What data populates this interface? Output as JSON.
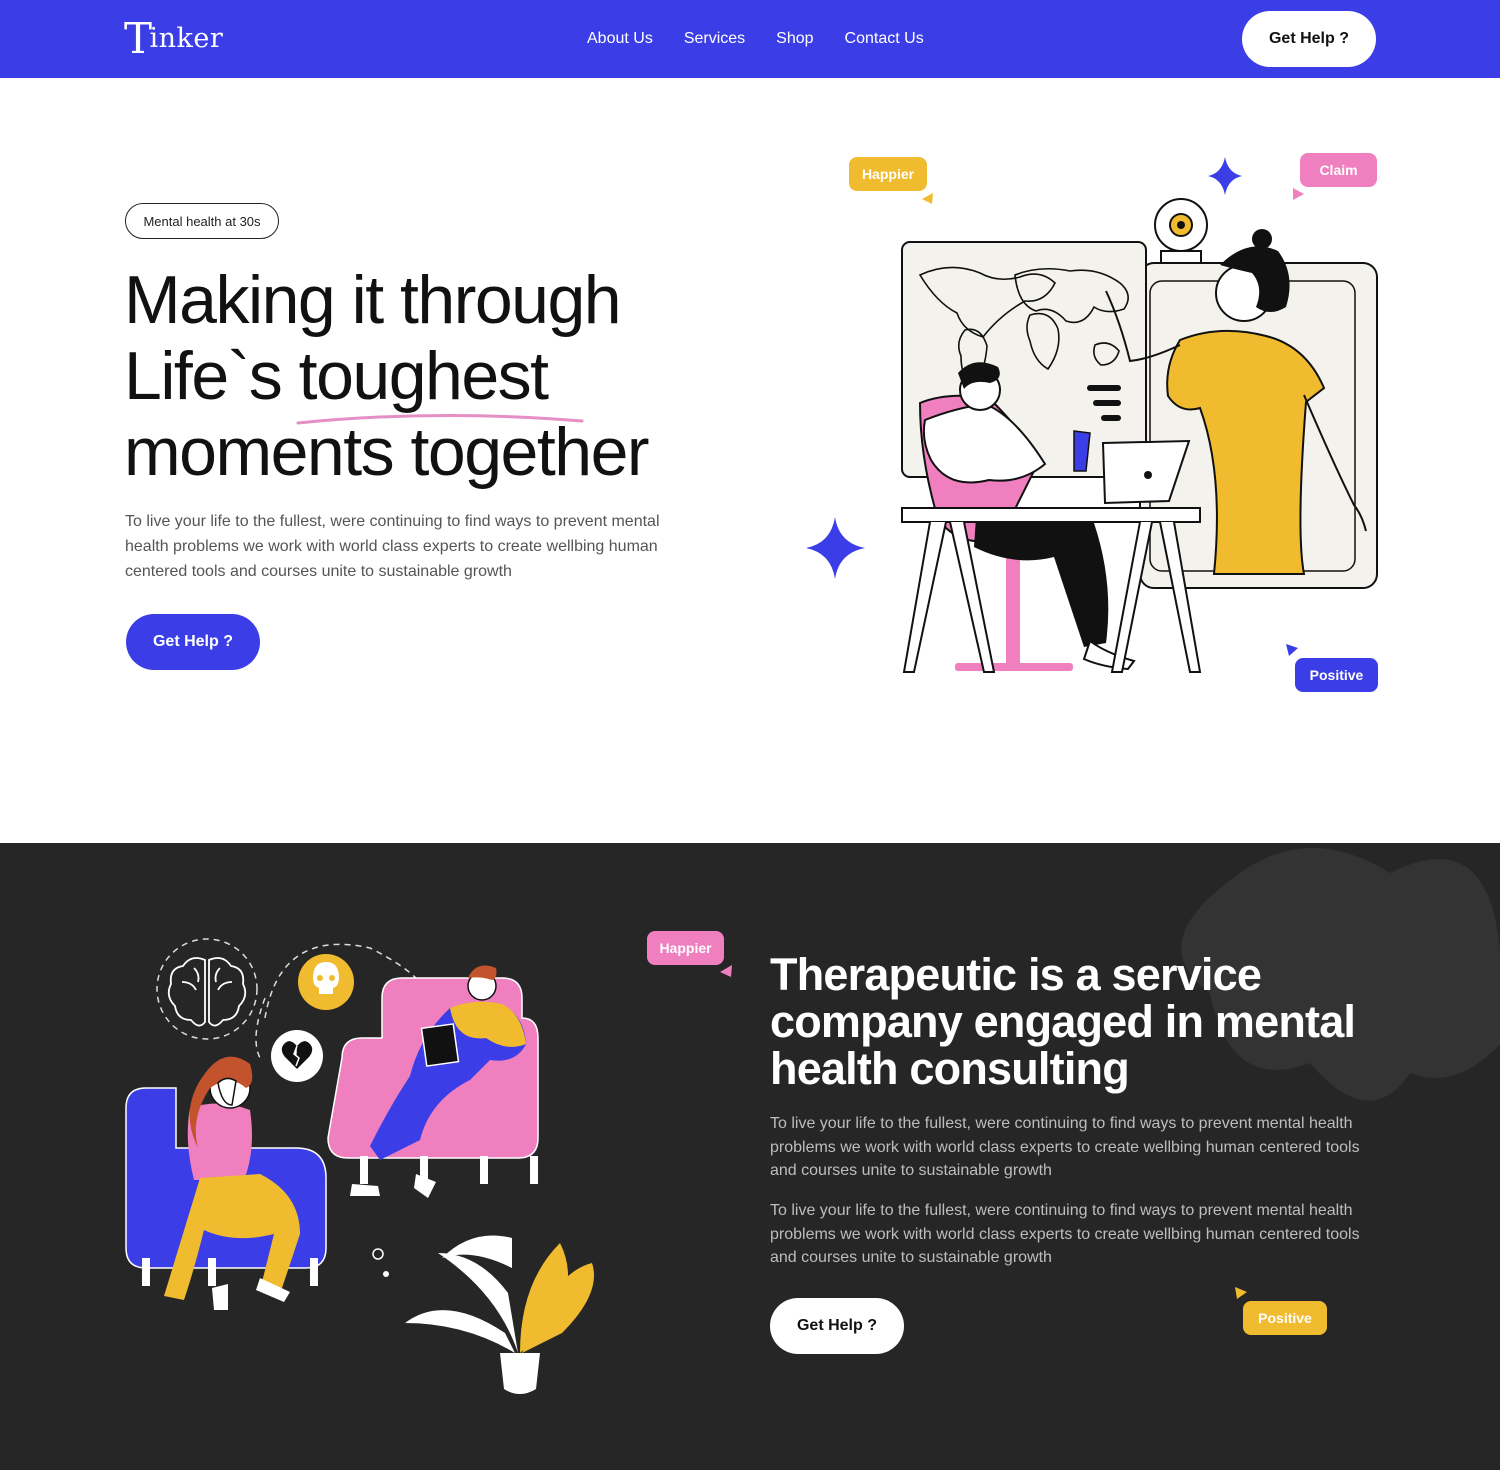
{
  "nav": {
    "logo_initial": "T",
    "logo_rest": "inker",
    "links": [
      "About Us",
      "Services",
      "Shop",
      "Contact Us"
    ],
    "cta": "Get Help ?"
  },
  "hero": {
    "pill": "Mental health at 30s",
    "title_lines": [
      "Making it through",
      "Life`s toughest",
      "moments together"
    ],
    "description": "To live your life to the fullest, were continuing to find ways to prevent mental health problems we work with world class experts to create wellbing human centered tools and courses unite to sustainable growth",
    "cta": "Get Help ?",
    "tags": {
      "happier": "Happier",
      "claim": "Claim",
      "positive": "Positive"
    }
  },
  "about": {
    "title_lines": [
      "Therapeutic is a service",
      "company engaged in mental",
      "health consulting"
    ],
    "paragraphs": [
      "To live your life to the fullest, were continuing to find ways to prevent mental health problems we work with world class experts to create wellbing human centered tools and courses unite to sustainable growth",
      "To live your life to the fullest, were continuing to find ways to prevent mental health problems we work with world class experts to create wellbing human centered tools and courses unite to sustainable growth"
    ],
    "cta": "Get Help ?",
    "tags": {
      "happier": "Happier",
      "positive": "Positive"
    }
  },
  "colors": {
    "brand_blue": "#3b3ee6",
    "yellow": "#f0bb2e",
    "pink": "#ef7fbf",
    "dark_bg": "#262626"
  }
}
